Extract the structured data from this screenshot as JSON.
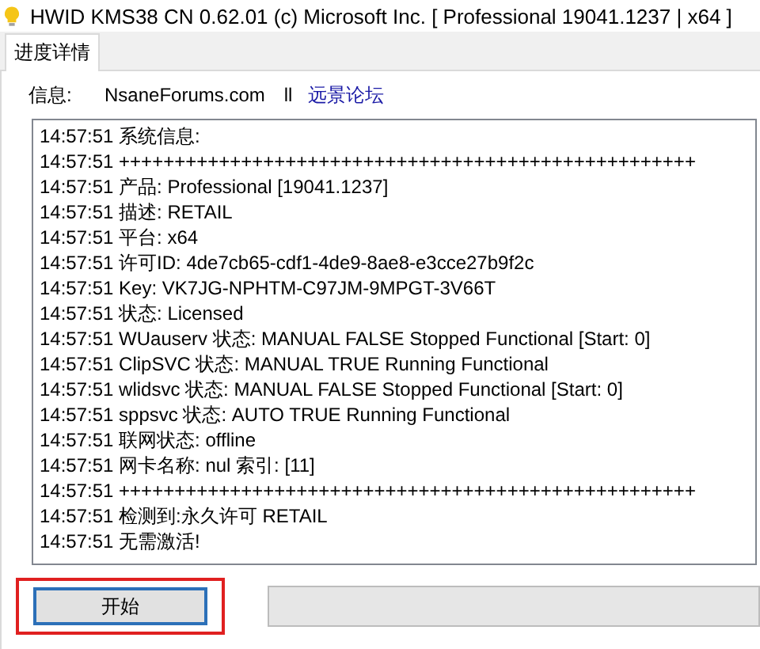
{
  "window": {
    "title": "HWID KMS38 CN 0.62.01 (c) Microsoft Inc. [ Professional 19041.1237 | x64 ]"
  },
  "tabs": [
    {
      "label": "进度详情",
      "selected": true
    }
  ],
  "info": {
    "label": "信息:",
    "site": "NsaneForums.com",
    "separator": "ll",
    "link": "远景论坛"
  },
  "log": [
    "14:57:51 系统信息:",
    "14:57:51 ++++++++++++++++++++++++++++++++++++++++++++++++++++",
    "14:57:51 产品: Professional [19041.1237]",
    "14:57:51 描述: RETAIL",
    "14:57:51 平台: x64",
    "14:57:51 许可ID: 4de7cb65-cdf1-4de9-8ae8-e3cce27b9f2c",
    "14:57:51 Key: VK7JG-NPHTM-C97JM-9MPGT-3V66T",
    "14:57:51 状态: Licensed",
    "14:57:51 WUauserv 状态: MANUAL FALSE Stopped Functional [Start: 0]",
    "14:57:51 ClipSVC 状态: MANUAL TRUE Running Functional",
    "14:57:51 wlidsvc 状态: MANUAL FALSE Stopped Functional [Start: 0]",
    "14:57:51 sppsvc 状态: AUTO TRUE Running Functional",
    "14:57:51 联网状态: offline",
    "14:57:51 网卡名称: nul 索引: [11]",
    "14:57:51 ++++++++++++++++++++++++++++++++++++++++++++++++++++",
    "14:57:51 检测到:永久许可 RETAIL",
    "14:57:51 无需激活!"
  ],
  "start_button": {
    "label": "开始",
    "highlighted": true
  }
}
